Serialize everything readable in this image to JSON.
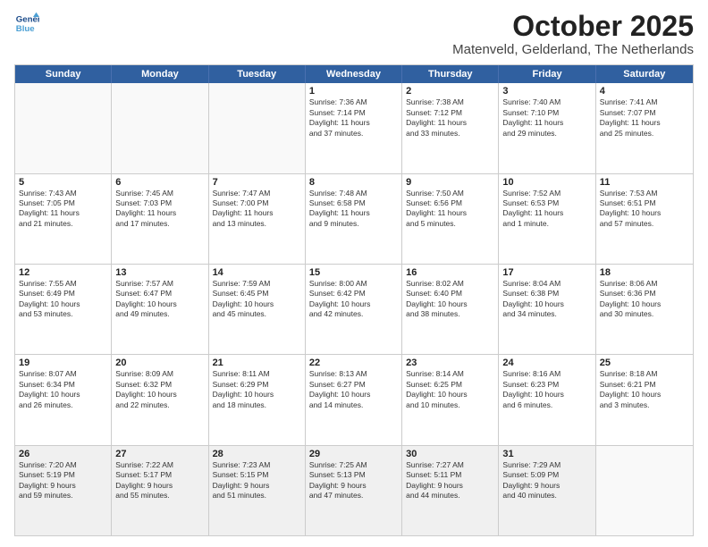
{
  "header": {
    "logo_line1": "General",
    "logo_line2": "Blue",
    "month": "October 2025",
    "location": "Matenveld, Gelderland, The Netherlands"
  },
  "weekdays": [
    "Sunday",
    "Monday",
    "Tuesday",
    "Wednesday",
    "Thursday",
    "Friday",
    "Saturday"
  ],
  "rows": [
    [
      {
        "day": "",
        "text": "",
        "empty": true
      },
      {
        "day": "",
        "text": "",
        "empty": true
      },
      {
        "day": "",
        "text": "",
        "empty": true
      },
      {
        "day": "1",
        "text": "Sunrise: 7:36 AM\nSunset: 7:14 PM\nDaylight: 11 hours\nand 37 minutes.",
        "empty": false
      },
      {
        "day": "2",
        "text": "Sunrise: 7:38 AM\nSunset: 7:12 PM\nDaylight: 11 hours\nand 33 minutes.",
        "empty": false
      },
      {
        "day": "3",
        "text": "Sunrise: 7:40 AM\nSunset: 7:10 PM\nDaylight: 11 hours\nand 29 minutes.",
        "empty": false
      },
      {
        "day": "4",
        "text": "Sunrise: 7:41 AM\nSunset: 7:07 PM\nDaylight: 11 hours\nand 25 minutes.",
        "empty": false
      }
    ],
    [
      {
        "day": "5",
        "text": "Sunrise: 7:43 AM\nSunset: 7:05 PM\nDaylight: 11 hours\nand 21 minutes.",
        "empty": false
      },
      {
        "day": "6",
        "text": "Sunrise: 7:45 AM\nSunset: 7:03 PM\nDaylight: 11 hours\nand 17 minutes.",
        "empty": false
      },
      {
        "day": "7",
        "text": "Sunrise: 7:47 AM\nSunset: 7:00 PM\nDaylight: 11 hours\nand 13 minutes.",
        "empty": false
      },
      {
        "day": "8",
        "text": "Sunrise: 7:48 AM\nSunset: 6:58 PM\nDaylight: 11 hours\nand 9 minutes.",
        "empty": false
      },
      {
        "day": "9",
        "text": "Sunrise: 7:50 AM\nSunset: 6:56 PM\nDaylight: 11 hours\nand 5 minutes.",
        "empty": false
      },
      {
        "day": "10",
        "text": "Sunrise: 7:52 AM\nSunset: 6:53 PM\nDaylight: 11 hours\nand 1 minute.",
        "empty": false
      },
      {
        "day": "11",
        "text": "Sunrise: 7:53 AM\nSunset: 6:51 PM\nDaylight: 10 hours\nand 57 minutes.",
        "empty": false
      }
    ],
    [
      {
        "day": "12",
        "text": "Sunrise: 7:55 AM\nSunset: 6:49 PM\nDaylight: 10 hours\nand 53 minutes.",
        "empty": false
      },
      {
        "day": "13",
        "text": "Sunrise: 7:57 AM\nSunset: 6:47 PM\nDaylight: 10 hours\nand 49 minutes.",
        "empty": false
      },
      {
        "day": "14",
        "text": "Sunrise: 7:59 AM\nSunset: 6:45 PM\nDaylight: 10 hours\nand 45 minutes.",
        "empty": false
      },
      {
        "day": "15",
        "text": "Sunrise: 8:00 AM\nSunset: 6:42 PM\nDaylight: 10 hours\nand 42 minutes.",
        "empty": false
      },
      {
        "day": "16",
        "text": "Sunrise: 8:02 AM\nSunset: 6:40 PM\nDaylight: 10 hours\nand 38 minutes.",
        "empty": false
      },
      {
        "day": "17",
        "text": "Sunrise: 8:04 AM\nSunset: 6:38 PM\nDaylight: 10 hours\nand 34 minutes.",
        "empty": false
      },
      {
        "day": "18",
        "text": "Sunrise: 8:06 AM\nSunset: 6:36 PM\nDaylight: 10 hours\nand 30 minutes.",
        "empty": false
      }
    ],
    [
      {
        "day": "19",
        "text": "Sunrise: 8:07 AM\nSunset: 6:34 PM\nDaylight: 10 hours\nand 26 minutes.",
        "empty": false
      },
      {
        "day": "20",
        "text": "Sunrise: 8:09 AM\nSunset: 6:32 PM\nDaylight: 10 hours\nand 22 minutes.",
        "empty": false
      },
      {
        "day": "21",
        "text": "Sunrise: 8:11 AM\nSunset: 6:29 PM\nDaylight: 10 hours\nand 18 minutes.",
        "empty": false
      },
      {
        "day": "22",
        "text": "Sunrise: 8:13 AM\nSunset: 6:27 PM\nDaylight: 10 hours\nand 14 minutes.",
        "empty": false
      },
      {
        "day": "23",
        "text": "Sunrise: 8:14 AM\nSunset: 6:25 PM\nDaylight: 10 hours\nand 10 minutes.",
        "empty": false
      },
      {
        "day": "24",
        "text": "Sunrise: 8:16 AM\nSunset: 6:23 PM\nDaylight: 10 hours\nand 6 minutes.",
        "empty": false
      },
      {
        "day": "25",
        "text": "Sunrise: 8:18 AM\nSunset: 6:21 PM\nDaylight: 10 hours\nand 3 minutes.",
        "empty": false
      }
    ],
    [
      {
        "day": "26",
        "text": "Sunrise: 7:20 AM\nSunset: 5:19 PM\nDaylight: 9 hours\nand 59 minutes.",
        "empty": false
      },
      {
        "day": "27",
        "text": "Sunrise: 7:22 AM\nSunset: 5:17 PM\nDaylight: 9 hours\nand 55 minutes.",
        "empty": false
      },
      {
        "day": "28",
        "text": "Sunrise: 7:23 AM\nSunset: 5:15 PM\nDaylight: 9 hours\nand 51 minutes.",
        "empty": false
      },
      {
        "day": "29",
        "text": "Sunrise: 7:25 AM\nSunset: 5:13 PM\nDaylight: 9 hours\nand 47 minutes.",
        "empty": false
      },
      {
        "day": "30",
        "text": "Sunrise: 7:27 AM\nSunset: 5:11 PM\nDaylight: 9 hours\nand 44 minutes.",
        "empty": false
      },
      {
        "day": "31",
        "text": "Sunrise: 7:29 AM\nSunset: 5:09 PM\nDaylight: 9 hours\nand 40 minutes.",
        "empty": false
      },
      {
        "day": "",
        "text": "",
        "empty": true
      }
    ]
  ]
}
